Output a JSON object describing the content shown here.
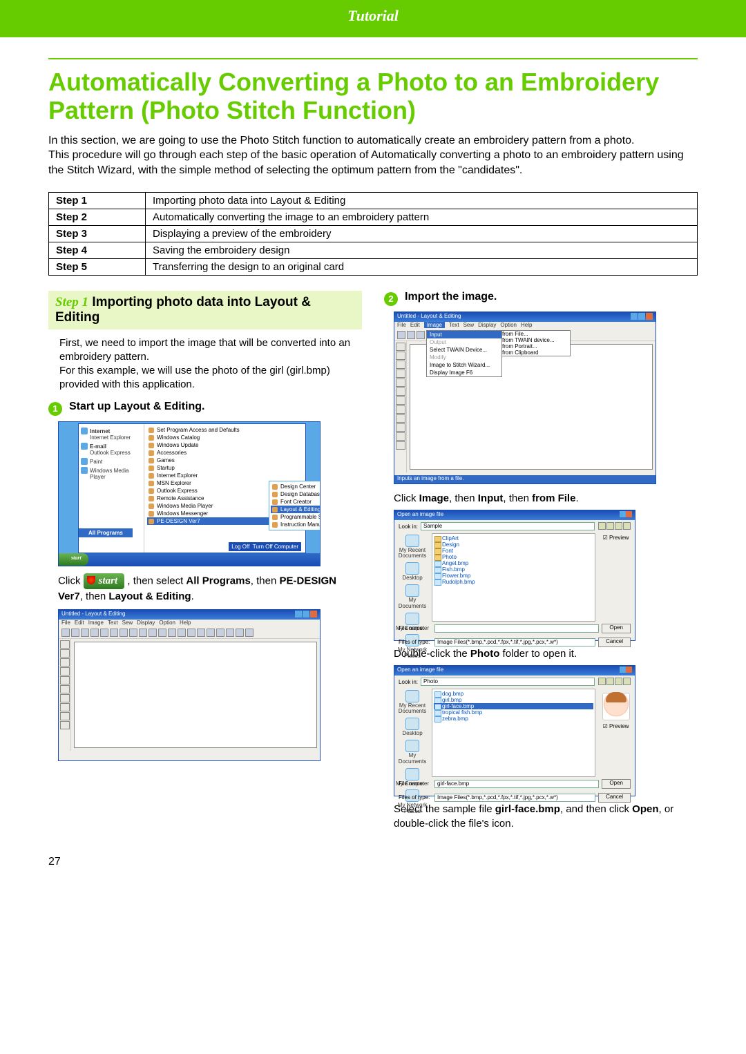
{
  "header": {
    "title": "Tutorial"
  },
  "page_number": "27",
  "h1": "Automatically Converting a Photo to an Embroidery Pattern (Photo Stitch Function)",
  "intro": "In this section, we are going to use the Photo Stitch function to automatically create an embroidery pattern from a photo.\nThis procedure will go through each step of the basic operation of Automatically converting a photo to an embroidery pattern using the Stitch Wizard, with the simple method of selecting the optimum pattern from the \"candidates\".",
  "steps_table": [
    {
      "step": "Step 1",
      "desc": "Importing photo data into Layout & Editing"
    },
    {
      "step": "Step 2",
      "desc": "Automatically converting the image to an embroidery pattern"
    },
    {
      "step": "Step 3",
      "desc": "Displaying a preview of the embroidery"
    },
    {
      "step": "Step 4",
      "desc": "Saving the embroidery design"
    },
    {
      "step": "Step 5",
      "desc": "Transferring the design to an original card"
    }
  ],
  "left": {
    "step_no": "Step 1",
    "step_title": "Importing photo data into Layout & Editing",
    "body_p1": "First, we need to import the image that will be converted into an embroidery pattern.",
    "body_p2": "For this example, we will use the photo of the girl (girl.bmp) provided with this application.",
    "sub1_no": "1",
    "sub1_title": "Start up Layout & Editing.",
    "start_menu": {
      "left_items": [
        "Internet",
        "Internet Explorer",
        "E-mail",
        "Outlook Express",
        "Paint",
        "Windows Media Player"
      ],
      "right_items": [
        "Set Program Access and Defaults",
        "Windows Catalog",
        "Windows Update",
        "Accessories",
        "Games",
        "Startup",
        "Internet Explorer",
        "MSN Explorer",
        "Outlook Express",
        "Remote Assistance",
        "Windows Media Player",
        "Windows Messenger",
        "PE-DESIGN Ver7"
      ],
      "submenu": [
        "Design Center",
        "Design Database",
        "Font Creator",
        "Layout & Editing",
        "Programmable Stitch Creator",
        "Instruction Manual (HTML Format)"
      ],
      "all_programs": "All Programs",
      "logoff": "Log Off",
      "turnoff": "Turn Off Computer",
      "start": "start"
    },
    "instr1_pre": "Click",
    "instr1_start": "start",
    "instr1_post_a": ", then select ",
    "instr1_all": "All Programs",
    "instr1_post_b": ", then ",
    "instr1_pe": "PE-DESIGN Ver7",
    "instr1_post_c": ", then ",
    "instr1_le": "Layout & Editing",
    "instr1_post_d": ".",
    "app": {
      "title": "Untitled - Layout & Editing",
      "menus": [
        "File",
        "Edit",
        "Image",
        "Text",
        "Sew",
        "Display",
        "Option",
        "Help"
      ]
    }
  },
  "right": {
    "sub2_no": "2",
    "sub2_title": "Import the image.",
    "app2": {
      "title": "Untitled - Layout & Editing",
      "menus": [
        "File",
        "Edit",
        "Image",
        "Text",
        "Sew",
        "Display",
        "Option",
        "Help"
      ],
      "image_menu": [
        "Input",
        "Output",
        "Select TWAIN Device...",
        "Modify",
        "Image to Stitch Wizard...",
        "Display Image          F6"
      ],
      "input_sub": [
        "from File...",
        "from TWAIN device...",
        "from Portrait...",
        "from Clipboard"
      ],
      "status": "Inputs an image from a file."
    },
    "instr2_a": "Click ",
    "instr2_b": "Image",
    "instr2_c": ", then ",
    "instr2_d": "Input",
    "instr2_e": ", then ",
    "instr2_f": "from File",
    "instr2_g": ".",
    "dialog1": {
      "title": "Open an image file",
      "lookin_lbl": "Look in:",
      "lookin_val": "Sample",
      "places": [
        "My Recent Documents",
        "Desktop",
        "My Documents",
        "My Computer",
        "My Network Places"
      ],
      "folders": [
        "ClipArt",
        "Design",
        "Font",
        "Photo",
        "Angel.bmp",
        "Fish.bmp",
        "Flower.bmp",
        "Rudolph.bmp"
      ],
      "preview_lbl": "Preview",
      "filename_lbl": "File name:",
      "filetype_lbl": "Files of type:",
      "filetype_val": "Image Files(*.bmp,*.pcd,*.fpx,*.tif,*.jpg,*.pcx,*.w*)",
      "open": "Open",
      "cancel": "Cancel"
    },
    "instr3_a": "Double-click the ",
    "instr3_b": "Photo",
    "instr3_c": " folder to open it.",
    "dialog2": {
      "title": "Open an image file",
      "lookin_lbl": "Look in:",
      "lookin_val": "Photo",
      "folders": [
        "dog.bmp",
        "girl.bmp",
        "girl-face.bmp",
        "tropical fish.bmp",
        "zebra.bmp"
      ],
      "selected": "girl-face.bmp",
      "filename_lbl": "File name:",
      "filename_val": "girl-face.bmp",
      "filetype_lbl": "Files of type:",
      "filetype_val": "Image Files(*.bmp,*.pcd,*.fpx,*.tif,*.jpg,*.pcx,*.w*)",
      "preview_lbl": "Preview",
      "open": "Open",
      "cancel": "Cancel"
    },
    "instr4_a": "Select the sample file ",
    "instr4_b": "girl-face.bmp",
    "instr4_c": ", and then click ",
    "instr4_d": "Open",
    "instr4_e": ", or double-click the file's icon."
  }
}
